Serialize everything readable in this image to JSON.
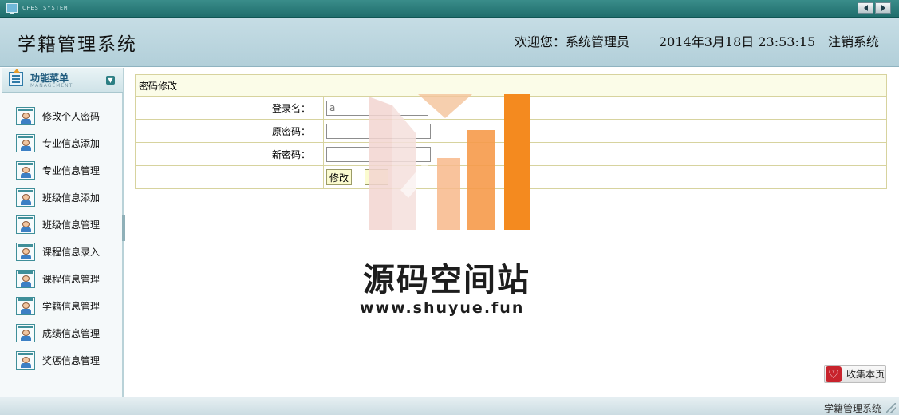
{
  "window": {
    "system_label": "CFES SYSTEM",
    "nav_icons": [
      "arrow-left-icon",
      "arrow-right-icon"
    ]
  },
  "header": {
    "title": "学籍管理系统",
    "welcome": "欢迎您：系统管理员",
    "datetime": "2014年3月18日  23:53:15",
    "logout": "注销系统"
  },
  "sidebar": {
    "title": "功能菜单",
    "subtitle": "MANAGEMENT",
    "items": [
      {
        "label": "修改个人密码",
        "icon": "user-card-icon",
        "active": true
      },
      {
        "label": "专业信息添加",
        "icon": "user-card-icon"
      },
      {
        "label": "专业信息管理",
        "icon": "user-card-icon"
      },
      {
        "label": "班级信息添加",
        "icon": "user-card-icon"
      },
      {
        "label": "班级信息管理",
        "icon": "user-card-icon"
      },
      {
        "label": "课程信息录入",
        "icon": "user-card-icon"
      },
      {
        "label": "课程信息管理",
        "icon": "user-card-icon"
      },
      {
        "label": "学籍信息管理",
        "icon": "user-card-icon"
      },
      {
        "label": "成绩信息管理",
        "icon": "user-card-icon"
      },
      {
        "label": "奖惩信息管理",
        "icon": "user-card-icon"
      }
    ]
  },
  "form": {
    "title": "密码修改",
    "username_label": "登录名：",
    "username_value": "a",
    "old_password_label": "原密码：",
    "new_password_label": "新密码：",
    "submit_label": "修改"
  },
  "watermark": {
    "text": "源码空间站",
    "url": "www.shuyue.fun"
  },
  "bookmark": {
    "label": "收集本页"
  },
  "footer": {
    "text": "学籍管理系统"
  },
  "colors": {
    "accent": "#2c7f84",
    "header_bg": "#c6dde5",
    "form_border": "#d7d39e",
    "button_bg": "#fbfbcf"
  }
}
